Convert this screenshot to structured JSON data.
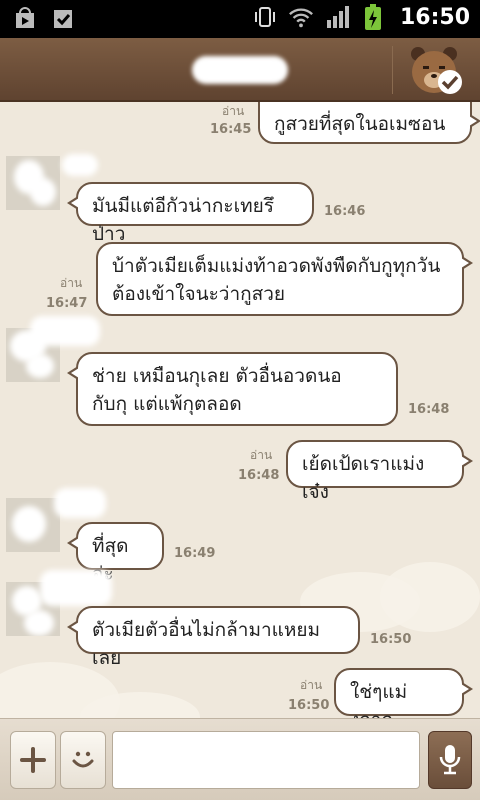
{
  "status_bar": {
    "time": "16:50",
    "icons": [
      "play-store-icon",
      "check-shield-icon",
      "vibrate-icon",
      "wifi-icon",
      "signal-icon",
      "battery-charging-icon"
    ]
  },
  "header": {
    "bear_button_icon": "bear-check-icon"
  },
  "messages": [
    {
      "dir": "out",
      "text": "กูสวยที่สุดในอเมซอน",
      "time": "16:45",
      "read": "อ่าน"
    },
    {
      "dir": "in",
      "text": "มันมีแต่อีกัวน่ากะเทยรึป่าว",
      "time": "16:46"
    },
    {
      "dir": "out",
      "lines": [
        "บ้าตัวเมียเต็มแม่งท้าอวดพังพืดกับกูทุกวัน",
        "ต้องเข้าใจนะว่ากูสวย"
      ],
      "time": "16:47",
      "read": "อ่าน"
    },
    {
      "dir": "in",
      "lines": [
        "ช่าย เหมือนกุเลย  ตัวอื่นอวดนอ",
        "กับกุ แต่แพ้กุตลอด"
      ],
      "time": "16:48"
    },
    {
      "dir": "out",
      "text": "เย้ดเป้ดเราแม่งเจ๋ง",
      "time": "16:48",
      "read": "อ่าน"
    },
    {
      "dir": "in",
      "text": "ที่สุดอ่ะ",
      "time": "16:49"
    },
    {
      "dir": "in",
      "text": "ตัวเมียตัวอื่นไม่กล้ามาแหยมเลย",
      "time": "16:50"
    },
    {
      "dir": "out",
      "text": "ใช่ๆแม่งกาก",
      "time": "16:50",
      "read": "อ่าน"
    }
  ],
  "input_bar": {
    "add_icon": "plus-icon",
    "sticker_icon": "smiley-icon",
    "message_value": "",
    "mic_icon": "microphone-icon"
  },
  "colors": {
    "header": "#6e503a",
    "bubble_border": "#6b5543",
    "chat_background": "#efe8dc"
  }
}
